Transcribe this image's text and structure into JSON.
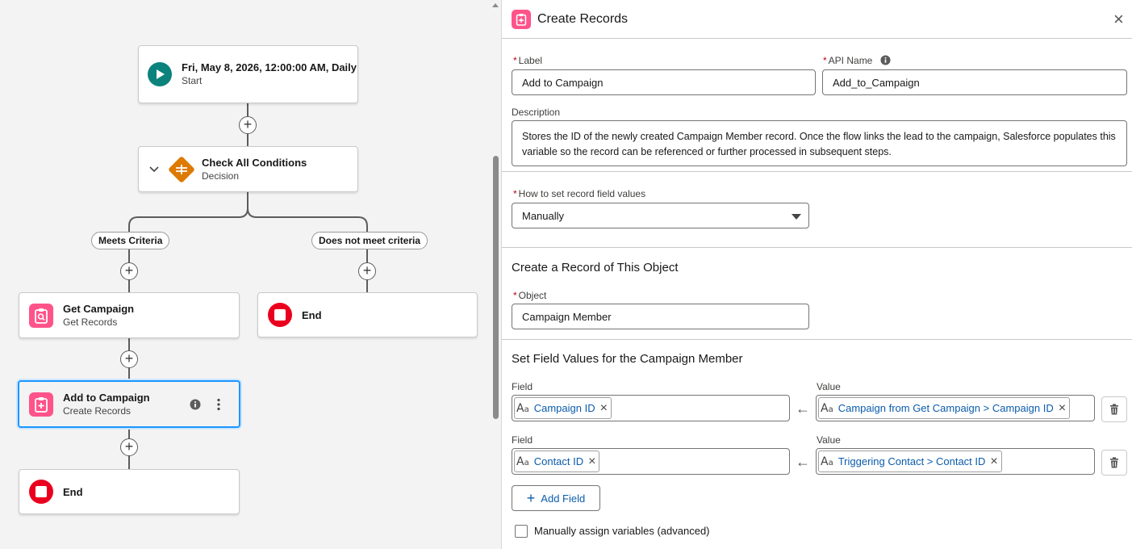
{
  "canvas": {
    "start": {
      "title": "Fri, May 8, 2026, 12:00:00 AM, Daily",
      "subtitle": "Start"
    },
    "decision": {
      "title": "Check All Conditions",
      "subtitle": "Decision"
    },
    "branch_yes": "Meets Criteria",
    "branch_no": "Does not meet criteria",
    "get_campaign": {
      "title": "Get Campaign",
      "subtitle": "Get Records"
    },
    "add_to_campaign": {
      "title": "Add to Campaign",
      "subtitle": "Create Records"
    },
    "end_right": {
      "title": "End"
    },
    "end_bottom": {
      "title": "End"
    },
    "plus_glyph": "+"
  },
  "panel": {
    "header_title": "Create Records",
    "close_glyph": "×",
    "label_label": "Label",
    "label_value": "Add to Campaign",
    "api_label": "API Name",
    "api_value": "Add_to_Campaign",
    "description_label": "Description",
    "description_value": "Stores the ID of the newly created Campaign Member record. Once the flow links the lead to the campaign, Salesforce populates this variable so the record can be referenced or further processed in subsequent steps.",
    "how_label": "How to set record field values",
    "how_value": "Manually",
    "object_section_title": "Create a Record of This Object",
    "object_label": "Object",
    "object_value": "Campaign Member",
    "field_values_title": "Set Field Values for the Campaign Member",
    "rows": [
      {
        "field_label": "Field",
        "field": "Campaign ID",
        "value_label": "Value",
        "value": "Campaign from Get Campaign > Campaign ID"
      },
      {
        "field_label": "Field",
        "field": "Contact ID",
        "value_label": "Value",
        "value": "Triggering Contact > Contact ID"
      }
    ],
    "add_field_label": "Add Field",
    "manual_assign_label": "Manually assign variables (advanced)",
    "manual_assign_checked": false
  },
  "colors": {
    "start": "#0b827c",
    "decision": "#dd7a01",
    "records": "#ff538a",
    "end": "#ea001e",
    "selected": "#1b96ff",
    "link": "#0b5cab"
  }
}
